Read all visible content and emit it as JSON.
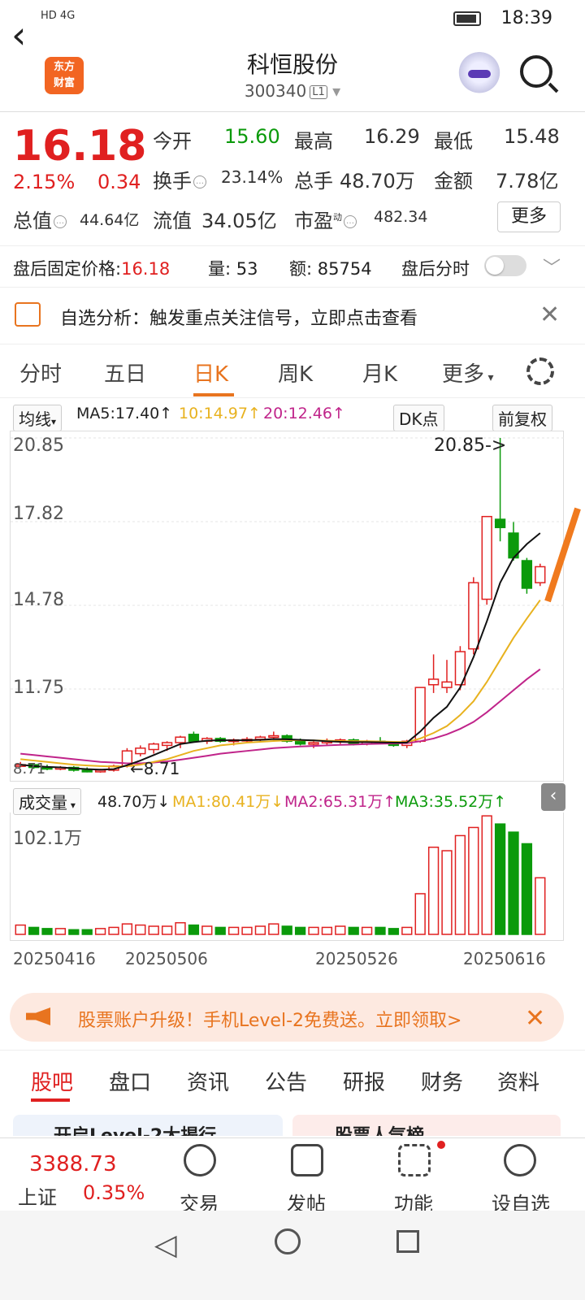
{
  "status": {
    "left": "HD 4G",
    "time": "18:39"
  },
  "header": {
    "title": "科恒股份",
    "code": "300340",
    "level": "L1",
    "logo_line1": "东方",
    "logo_line2": "财富"
  },
  "quote": {
    "price": "16.18",
    "pct": "2.15%",
    "change": "0.34",
    "open_label": "今开",
    "open": "15.60",
    "high_label": "最高",
    "high": "16.29",
    "low_label": "最低",
    "low": "15.48",
    "turnover_label": "换手",
    "turnover": "23.14%",
    "volume_label": "总手",
    "volume": "48.70万",
    "amount_label": "金额",
    "amount": "7.78亿",
    "mktcap_label": "总值",
    "mktcap": "44.64亿",
    "float_label": "流值",
    "float": "34.05亿",
    "pe_label": "市盈",
    "pe_sup": "动",
    "pe": "482.34",
    "more": "更多"
  },
  "afterhours": {
    "price_label": "盘后固定价格:",
    "price": "16.18",
    "vol_label": "量:",
    "vol": "53",
    "amt_label": "额:",
    "amt": "85754",
    "timeshare_label": "盘后分时"
  },
  "notice": {
    "text": "自选分析：触发重点关注信号，立即点击查看"
  },
  "tabs": [
    "分时",
    "五日",
    "日K",
    "周K",
    "月K",
    "更多"
  ],
  "ma": {
    "selector": "均线",
    "ma5": "MA5:17.40↑",
    "ma10": "10:14.97↑",
    "ma20": "20:12.46↑",
    "dk": "DK点",
    "fq": "前复权"
  },
  "chart_labels": {
    "y1": "20.85",
    "y2": "17.82",
    "y3": "14.78",
    "y4": "11.75",
    "y5": "8.71",
    "high_annot": "20.85->",
    "low_annot": "←8.71"
  },
  "vol_bar": {
    "selector": "成交量",
    "val": "48.70万↓",
    "ma1": "MA1:80.41万↓",
    "ma2": "MA2:65.31万↑",
    "ma3": "MA3:35.52万↑",
    "ymax": "102.1万"
  },
  "dates": [
    "20250416",
    "20250506",
    "20250526",
    "20250616"
  ],
  "promo": {
    "text": "股票账户升级！手机Level-2免费送。立即领取>"
  },
  "bottom_tabs": [
    "股吧",
    "盘口",
    "资讯",
    "公告",
    "研报",
    "财务",
    "资料"
  ],
  "peek": {
    "left": "开启Level-2大揭行",
    "right": "股票人气榜"
  },
  "dock": {
    "index_value": "3388.73",
    "index_name": "上证",
    "index_pct": "0.35%",
    "trade": "交易",
    "post": "发帖",
    "func": "功能",
    "watch": "设自选"
  },
  "colors": {
    "up": "#e02020",
    "down": "#0b9a0b",
    "accent": "#e8741f"
  },
  "chart_data": {
    "type": "candlestick",
    "ylim": [
      8.71,
      20.85
    ],
    "candles": [
      {
        "o": 9.0,
        "h": 9.1,
        "l": 8.9,
        "c": 9.0
      },
      {
        "o": 9.0,
        "h": 9.05,
        "l": 8.85,
        "c": 8.9
      },
      {
        "o": 8.9,
        "h": 9.0,
        "l": 8.8,
        "c": 8.85
      },
      {
        "o": 8.85,
        "h": 8.95,
        "l": 8.8,
        "c": 8.9
      },
      {
        "o": 8.9,
        "h": 8.95,
        "l": 8.75,
        "c": 8.8
      },
      {
        "o": 8.8,
        "h": 8.9,
        "l": 8.72,
        "c": 8.75
      },
      {
        "o": 8.75,
        "h": 8.85,
        "l": 8.71,
        "c": 8.8
      },
      {
        "o": 8.8,
        "h": 9.0,
        "l": 8.75,
        "c": 8.95
      },
      {
        "o": 8.95,
        "h": 9.6,
        "l": 8.9,
        "c": 9.5
      },
      {
        "o": 9.4,
        "h": 9.7,
        "l": 9.3,
        "c": 9.6
      },
      {
        "o": 9.55,
        "h": 9.8,
        "l": 9.4,
        "c": 9.75
      },
      {
        "o": 9.7,
        "h": 9.85,
        "l": 9.5,
        "c": 9.8
      },
      {
        "o": 9.8,
        "h": 10.05,
        "l": 9.6,
        "c": 10.0
      },
      {
        "o": 10.1,
        "h": 10.2,
        "l": 9.8,
        "c": 9.85
      },
      {
        "o": 9.85,
        "h": 10.0,
        "l": 9.75,
        "c": 9.95
      },
      {
        "o": 9.95,
        "h": 10.0,
        "l": 9.8,
        "c": 9.85
      },
      {
        "o": 9.85,
        "h": 9.95,
        "l": 9.7,
        "c": 9.9
      },
      {
        "o": 9.9,
        "h": 10.0,
        "l": 9.8,
        "c": 9.92
      },
      {
        "o": 9.92,
        "h": 10.05,
        "l": 9.85,
        "c": 10.0
      },
      {
        "o": 10.0,
        "h": 10.2,
        "l": 9.9,
        "c": 10.05
      },
      {
        "o": 10.05,
        "h": 10.1,
        "l": 9.8,
        "c": 9.85
      },
      {
        "o": 9.85,
        "h": 9.95,
        "l": 9.7,
        "c": 9.75
      },
      {
        "o": 9.75,
        "h": 9.85,
        "l": 9.6,
        "c": 9.8
      },
      {
        "o": 9.8,
        "h": 9.95,
        "l": 9.7,
        "c": 9.85
      },
      {
        "o": 9.85,
        "h": 9.95,
        "l": 9.75,
        "c": 9.9
      },
      {
        "o": 9.9,
        "h": 9.95,
        "l": 9.7,
        "c": 9.75
      },
      {
        "o": 9.75,
        "h": 9.9,
        "l": 9.7,
        "c": 9.85
      },
      {
        "o": 9.85,
        "h": 10.0,
        "l": 9.75,
        "c": 9.8
      },
      {
        "o": 9.8,
        "h": 9.85,
        "l": 9.65,
        "c": 9.7
      },
      {
        "o": 9.7,
        "h": 9.9,
        "l": 9.6,
        "c": 9.85
      },
      {
        "o": 9.85,
        "h": 11.8,
        "l": 9.8,
        "c": 11.8
      },
      {
        "o": 11.9,
        "h": 13.0,
        "l": 11.6,
        "c": 12.1
      },
      {
        "o": 11.8,
        "h": 12.8,
        "l": 11.6,
        "c": 12.0
      },
      {
        "o": 11.9,
        "h": 13.3,
        "l": 11.7,
        "c": 13.1
      },
      {
        "o": 13.2,
        "h": 15.8,
        "l": 13.0,
        "c": 15.6
      },
      {
        "o": 15.0,
        "h": 18.0,
        "l": 14.8,
        "c": 18.0
      },
      {
        "o": 17.9,
        "h": 20.85,
        "l": 17.1,
        "c": 17.6
      },
      {
        "o": 17.4,
        "h": 17.8,
        "l": 16.4,
        "c": 16.5
      },
      {
        "o": 16.4,
        "h": 16.5,
        "l": 15.2,
        "c": 15.4
      },
      {
        "o": 15.6,
        "h": 16.29,
        "l": 15.48,
        "c": 16.18
      }
    ],
    "ma5": [
      9.0,
      8.95,
      8.92,
      8.9,
      8.87,
      8.84,
      8.82,
      8.84,
      8.98,
      9.15,
      9.35,
      9.55,
      9.75,
      9.82,
      9.87,
      9.89,
      9.88,
      9.89,
      9.9,
      9.93,
      9.92,
      9.9,
      9.88,
      9.85,
      9.83,
      9.82,
      9.82,
      9.81,
      9.8,
      9.8,
      10.2,
      10.7,
      11.1,
      11.8,
      12.9,
      14.2,
      15.6,
      16.5,
      17.0,
      17.4
    ],
    "ma10": [
      9.2,
      9.15,
      9.1,
      9.05,
      9.0,
      8.97,
      8.95,
      8.93,
      8.95,
      9.0,
      9.1,
      9.2,
      9.35,
      9.5,
      9.6,
      9.7,
      9.75,
      9.8,
      9.83,
      9.86,
      9.88,
      9.89,
      9.88,
      9.87,
      9.86,
      9.85,
      9.85,
      9.84,
      9.83,
      9.82,
      9.95,
      10.15,
      10.4,
      10.8,
      11.3,
      12.0,
      12.8,
      13.6,
      14.3,
      14.97
    ],
    "ma20": [
      9.4,
      9.35,
      9.3,
      9.25,
      9.2,
      9.15,
      9.1,
      9.08,
      9.05,
      9.05,
      9.08,
      9.12,
      9.18,
      9.25,
      9.32,
      9.4,
      9.45,
      9.5,
      9.55,
      9.6,
      9.63,
      9.66,
      9.68,
      9.7,
      9.72,
      9.73,
      9.75,
      9.76,
      9.77,
      9.78,
      9.85,
      9.95,
      10.1,
      10.3,
      10.55,
      10.9,
      11.3,
      11.7,
      12.1,
      12.46
    ],
    "volume": [
      8,
      6,
      5,
      5,
      4,
      4,
      5,
      6,
      9,
      8,
      7,
      7,
      10,
      8,
      7,
      6,
      6,
      6,
      7,
      9,
      7,
      6,
      6,
      6,
      7,
      6,
      6,
      6,
      5,
      6,
      35,
      75,
      72,
      85,
      92,
      102,
      95,
      88,
      78,
      48.7
    ],
    "vol_ymax": 102.1
  }
}
